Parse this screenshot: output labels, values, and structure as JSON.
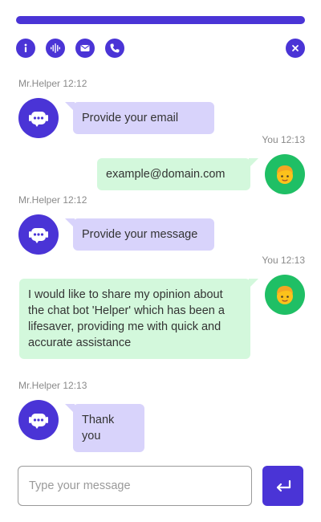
{
  "colors": {
    "accent": "#4a34d6",
    "bot_bubble": "#d8d3fb",
    "user_bubble": "#d3f8dc",
    "user_avatar_bg": "#1fbf65"
  },
  "toolbar": {
    "icons": [
      "info-icon",
      "soundwave-icon",
      "mail-icon",
      "phone-icon"
    ],
    "close_icon": "close-icon"
  },
  "messages": [
    {
      "sender": "Mr.Helper",
      "time": "12:12",
      "text": "Provide your email"
    },
    {
      "sender": "You",
      "time": "12:13",
      "text": "example@domain.com"
    },
    {
      "sender": "Mr.Helper",
      "time": "12:12",
      "text": "Provide your message"
    },
    {
      "sender": "You",
      "time": "12:13",
      "text": "I would like to share my opinion about the chat bot 'Helper' which has been a lifesaver, providing me with quick and accurate assistance"
    },
    {
      "sender": "Mr.Helper",
      "time": "12:13",
      "text": "Thank you"
    }
  ],
  "composer": {
    "placeholder": "Type your message",
    "send_icon": "enter-icon"
  }
}
